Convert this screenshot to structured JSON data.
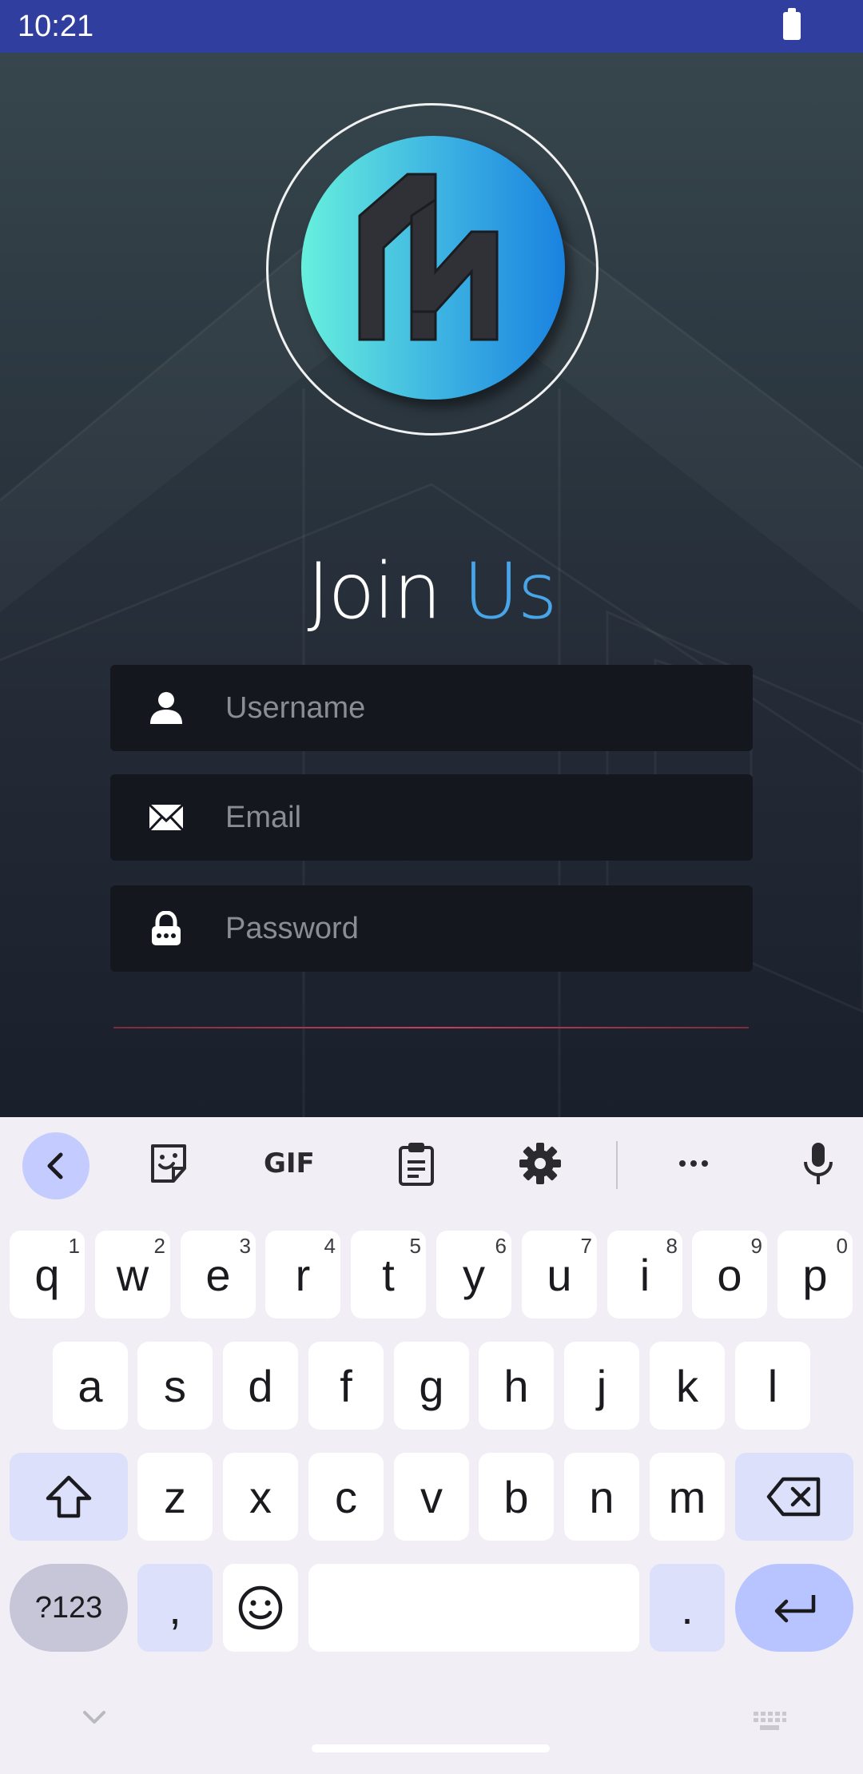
{
  "status_bar": {
    "time": "10:21"
  },
  "app": {
    "title_part1": "Join ",
    "title_part2": "Us",
    "fields": {
      "username_placeholder": "Username",
      "email_placeholder": "Email",
      "password_placeholder": "Password"
    },
    "icons": {
      "username": "person-icon",
      "email": "envelope-icon",
      "password": "lock-icon"
    },
    "colors": {
      "accent": "#48a6e8",
      "divider": "#c2405a"
    }
  },
  "keyboard": {
    "toolbar": [
      "back-icon",
      "sticker-icon",
      "gif-icon",
      "clipboard-icon",
      "settings-icon",
      "more-icon",
      "mic-icon"
    ],
    "gif_label": "GIF",
    "row1": [
      {
        "k": "q",
        "h": "1"
      },
      {
        "k": "w",
        "h": "2"
      },
      {
        "k": "e",
        "h": "3"
      },
      {
        "k": "r",
        "h": "4"
      },
      {
        "k": "t",
        "h": "5"
      },
      {
        "k": "y",
        "h": "6"
      },
      {
        "k": "u",
        "h": "7"
      },
      {
        "k": "i",
        "h": "8"
      },
      {
        "k": "o",
        "h": "9"
      },
      {
        "k": "p",
        "h": "0"
      }
    ],
    "row2": [
      "a",
      "s",
      "d",
      "f",
      "g",
      "h",
      "j",
      "k",
      "l"
    ],
    "row3": [
      "z",
      "x",
      "c",
      "v",
      "b",
      "n",
      "m"
    ],
    "sym_label": "?123",
    "comma": ",",
    "period": "."
  }
}
